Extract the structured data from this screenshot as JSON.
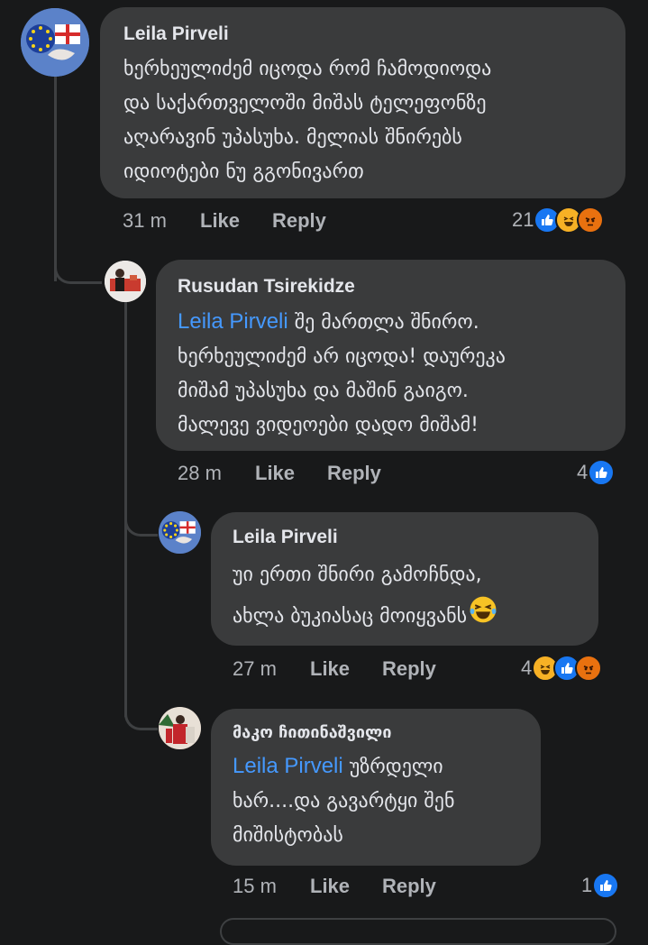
{
  "comments": [
    {
      "author": "Leila Pirveli",
      "mention": "",
      "text_lines": [
        "ხერხეულიძემ იცოდა რომ ჩამოდიოდა",
        "და საქართველოში მიშას ტელეფონზე",
        "აღარავინ უპასუხა. მელიას შნირებს",
        "იდიოტები ნუ გგონივართ"
      ],
      "time": "31 m",
      "like": "Like",
      "reply": "Reply",
      "reaction_count": "21",
      "reactions": [
        "like-icon",
        "haha-icon",
        "angry-icon"
      ]
    },
    {
      "author": "Rusudan Tsirekidze",
      "mention": "Leila Pirveli",
      "text_first": " შე მართლა შნირო.",
      "text_lines": [
        "ხერხეულიძემ არ იცოდა! დაურეკა",
        "მიშამ უპასუხა და მაშინ გაიგო.",
        "მალევე ვიდეოები დადო მიშამ!"
      ],
      "time": "28 m",
      "like": "Like",
      "reply": "Reply",
      "reaction_count": "4",
      "reactions": [
        "like-icon"
      ]
    },
    {
      "author": "Leila Pirveli",
      "mention": "",
      "text_lines": [
        "უი ერთი შნირი გამოჩნდა,",
        "ახლა ბუკიასაც მოიყვანს"
      ],
      "emoji": "tears-of-joy-emoji",
      "time": "27 m",
      "like": "Like",
      "reply": "Reply",
      "reaction_count": "4",
      "reactions": [
        "haha-icon",
        "like-icon",
        "angry-icon"
      ]
    },
    {
      "author": "მაკო ჩითინაშვილი",
      "mention": "Leila Pirveli",
      "text_first": " უზრდელი",
      "text_lines": [
        "ხარ....და გავარტყი შენ",
        "მიშისტობას"
      ],
      "time": "15 m",
      "like": "Like",
      "reply": "Reply",
      "reaction_count": "1",
      "reactions": [
        "like-icon"
      ]
    }
  ],
  "colors": {
    "background": "#18191a",
    "bubble": "#3a3b3c",
    "mention": "#4599ff",
    "meta": "#b0b3b8",
    "like_reaction": "#1877f2",
    "haha_reaction": "#f7b125",
    "angry_reaction": "#e9710f"
  }
}
